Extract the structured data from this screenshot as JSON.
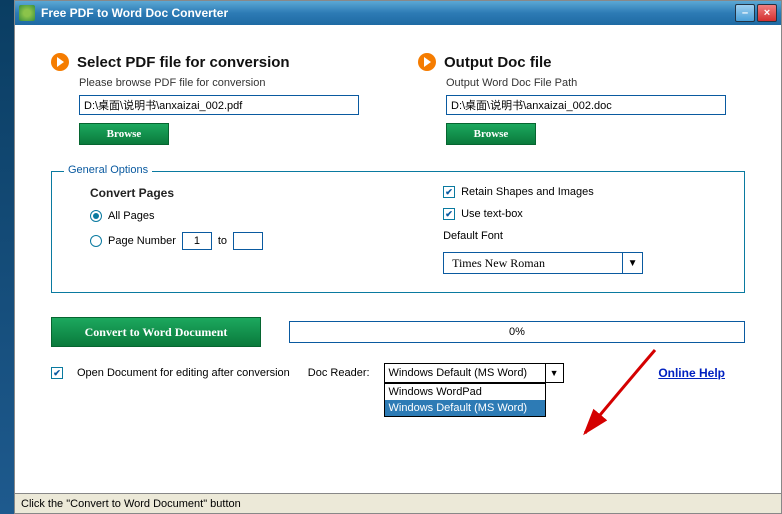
{
  "titlebar": {
    "app_title": "Free PDF to Word Doc Converter"
  },
  "input": {
    "heading": "Select PDF file for conversion",
    "hint": "Please browse PDF file for conversion",
    "path": "D:\\桌面\\说明书\\anxaizai_002.pdf",
    "browse": "Browse"
  },
  "output": {
    "heading": "Output Doc file",
    "hint": "Output Word Doc File Path",
    "path": "D:\\桌面\\说明书\\anxaizai_002.doc",
    "browse": "Browse"
  },
  "options": {
    "legend": "General Options",
    "pages_title": "Convert Pages",
    "all_pages": "All Pages",
    "page_number": "Page Number",
    "page_from": "1",
    "page_to_label": "to",
    "page_to": "",
    "retain_shapes": "Retain Shapes and Images",
    "use_text_box": "Use text-box",
    "default_font": "Default Font",
    "font": "Times New Roman"
  },
  "convert": {
    "button": "Convert to Word Document",
    "progress": "0%"
  },
  "footer": {
    "open_after": "Open Document for editing after conversion",
    "doc_reader_label": "Doc Reader:",
    "reader_selected": "Windows Default (MS Word)",
    "reader_options": [
      "Windows WordPad",
      "Windows Default (MS Word)"
    ],
    "online_help": "Online Help"
  },
  "statusbar": {
    "text": "Click the \"Convert to Word Document\" button"
  }
}
